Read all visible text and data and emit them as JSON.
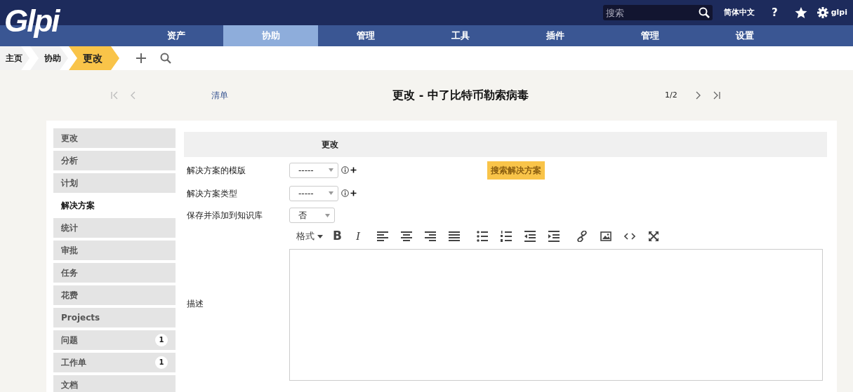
{
  "logo": {
    "text": "Glpi"
  },
  "top_bar": {
    "search": {
      "placeholder": "搜索"
    },
    "language": "简体中文",
    "help": "?",
    "user": "glpi"
  },
  "menu": [
    {
      "label": "资产",
      "selected": false
    },
    {
      "label": "协助",
      "selected": true
    },
    {
      "label": "管理",
      "selected": false
    },
    {
      "label": "工具",
      "selected": false
    },
    {
      "label": "插件",
      "selected": false
    },
    {
      "label": "管理",
      "selected": false
    },
    {
      "label": "设置",
      "selected": false
    }
  ],
  "breadcrumb": [
    {
      "label": "主页",
      "selected": false
    },
    {
      "label": "协助",
      "selected": false
    },
    {
      "label": "更改",
      "selected": true
    }
  ],
  "pager": {
    "list_link": "清单",
    "title": "更改 - 中了比特币勒索病毒",
    "position": "1/2"
  },
  "sidebar": {
    "items": [
      {
        "label": "更改",
        "selected": false
      },
      {
        "label": "分析",
        "selected": false
      },
      {
        "label": "计划",
        "selected": false
      },
      {
        "label": "解决方案",
        "selected": true
      },
      {
        "label": "统计",
        "selected": false
      },
      {
        "label": "审批",
        "selected": false
      },
      {
        "label": "任务",
        "selected": false
      },
      {
        "label": "花费",
        "selected": false
      },
      {
        "label": "Projects",
        "selected": false
      },
      {
        "label": "问题",
        "selected": false,
        "count": "1"
      },
      {
        "label": "工作单",
        "selected": false,
        "count": "1"
      },
      {
        "label": "文档",
        "selected": false
      }
    ]
  },
  "form": {
    "header": "更改",
    "fields": [
      {
        "label": "解决方案的模版",
        "value": "-----",
        "kind": "dropdown-extra"
      },
      {
        "label": "解决方案类型",
        "value": "-----",
        "kind": "dropdown-extra"
      },
      {
        "label": "保存并添加到知识库",
        "value": "否",
        "kind": "dropdown"
      }
    ],
    "search_solution_button": "搜索解决方案",
    "description": {
      "label": "描述",
      "toolbar": [
        {
          "kind": "format",
          "label": "格式"
        },
        {
          "kind": "text-bold",
          "label": "B"
        },
        {
          "kind": "text-italic",
          "label": "I"
        },
        {
          "kind": "align-left"
        },
        {
          "kind": "align-center"
        },
        {
          "kind": "align-right"
        },
        {
          "kind": "justify"
        },
        {
          "kind": "bullets"
        },
        {
          "kind": "numbers"
        },
        {
          "kind": "outdent"
        },
        {
          "kind": "indent"
        },
        {
          "kind": "link"
        },
        {
          "kind": "image"
        },
        {
          "kind": "code"
        },
        {
          "kind": "fullscreen"
        }
      ]
    }
  }
}
